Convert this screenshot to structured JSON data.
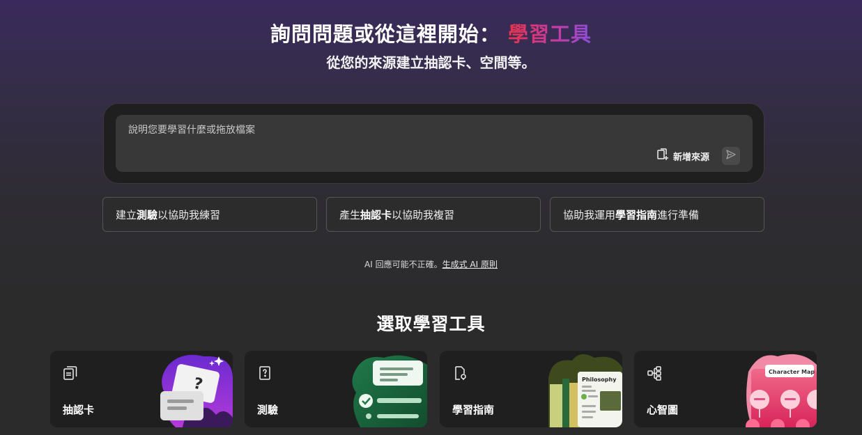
{
  "hero": {
    "title_prefix": "詢問問題或從這裡開始：",
    "title_accent": "學習工具",
    "subtitle": "從您的來源建立抽認卡、空間等。"
  },
  "prompt": {
    "placeholder": "說明您要學習什麼或拖放檔案",
    "add_source_label": "新增來源",
    "icons": {
      "add_source": "add-document-icon",
      "send": "send-icon"
    }
  },
  "suggestions": [
    {
      "pre": "建立",
      "bold": "測驗",
      "post": "以協助我練習"
    },
    {
      "pre": "產生",
      "bold": "抽認卡",
      "post": "以協助我複習"
    },
    {
      "pre": "協助我運用",
      "bold": "學習指南",
      "post": "進行準備"
    }
  ],
  "disclaimer": {
    "text": "AI 回應可能不正確。",
    "link": "生成式 AI 原則"
  },
  "tools_section": {
    "title": "選取學習工具",
    "items": [
      {
        "label": "抽認卡",
        "icon": "flashcards-icon"
      },
      {
        "label": "測驗",
        "icon": "quiz-icon"
      },
      {
        "label": "學習指南",
        "icon": "study-guide-icon"
      },
      {
        "label": "心智圖",
        "icon": "mind-map-icon",
        "art_caption": "Character Map"
      }
    ]
  },
  "art_text": {
    "study_guide_heading": "Philosophy"
  },
  "colors": {
    "accent_red": "#e8344a",
    "accent_purple": "#8b4fd8",
    "card_bg": "#1f1f1f",
    "page_bg": "#2b2b2b"
  }
}
